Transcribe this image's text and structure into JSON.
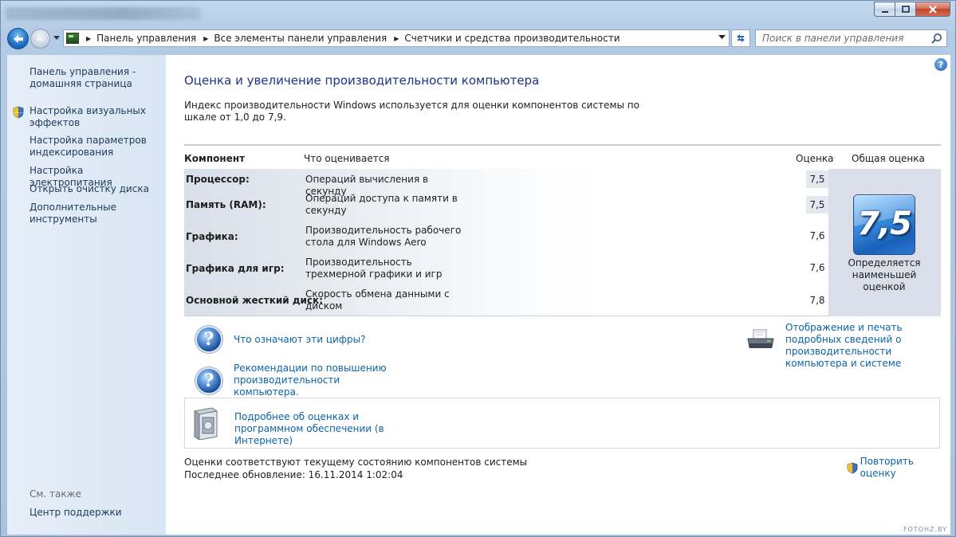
{
  "window": {
    "buttons": {
      "minimize": "minimize-icon",
      "maximize": "maximize-icon",
      "close": "close-icon"
    }
  },
  "address_bar": {
    "breadcrumbs": [
      "Панель управления",
      "Все элементы панели управления",
      "Счетчики и средства производительности"
    ],
    "search_placeholder": "Поиск в панели управления"
  },
  "sidebar": {
    "home_link": "Панель управления - домашняя страница",
    "links": [
      "Настройка визуальных эффектов",
      "Настройка параметров индексирования",
      "Настройка электропитания",
      "Открыть очистку диска",
      "Дополнительные инструменты"
    ],
    "see_also": "См. также",
    "support_center": "Центр поддержки"
  },
  "main": {
    "heading": "Оценка и увеличение производительности компьютера",
    "intro": "Индекс производительности Windows используется для оценки компонентов системы по шкале от 1,0 до 7,9.",
    "table": {
      "headers": {
        "component": "Компонент",
        "what": "Что оценивается",
        "score": "Оценка",
        "overall": "Общая оценка"
      },
      "rows": [
        {
          "component": "Процессор:",
          "what": "Операций вычисления в секунду",
          "score": "7,5"
        },
        {
          "component": "Память (RAM):",
          "what": "Операций доступа к памяти в секунду",
          "score": "7,5"
        },
        {
          "component": "Графика:",
          "what": "Производительность рабочего стола для Windows Aero",
          "score": "7,6"
        },
        {
          "component": "Графика для игр:",
          "what": "Производительность трехмерной графики и игр",
          "score": "7,6"
        },
        {
          "component": "Основной жесткий диск:",
          "what": "Скорость обмена данными с диском",
          "score": "7,8"
        }
      ],
      "overall_score": "7,5",
      "overall_caption": "Определяется наименьшей оценкой"
    },
    "links": {
      "what_numbers_mean": "Что означают эти цифры?",
      "tips": "Рекомендации по повышению производительности компьютера.",
      "print_details": "Отображение и печать подробных сведений о производительности компьютера и системе",
      "more_online": "Подробнее об оценках и программном обеспечении (в Интернете)"
    },
    "footer": {
      "status": "Оценки соответствуют текущему состоянию компонентов системы",
      "last_update": "Последнее обновление: 16.11.2014 1:02:04",
      "rerun": "Повторить оценку"
    },
    "watermark": "FOTOHZ.BY"
  }
}
